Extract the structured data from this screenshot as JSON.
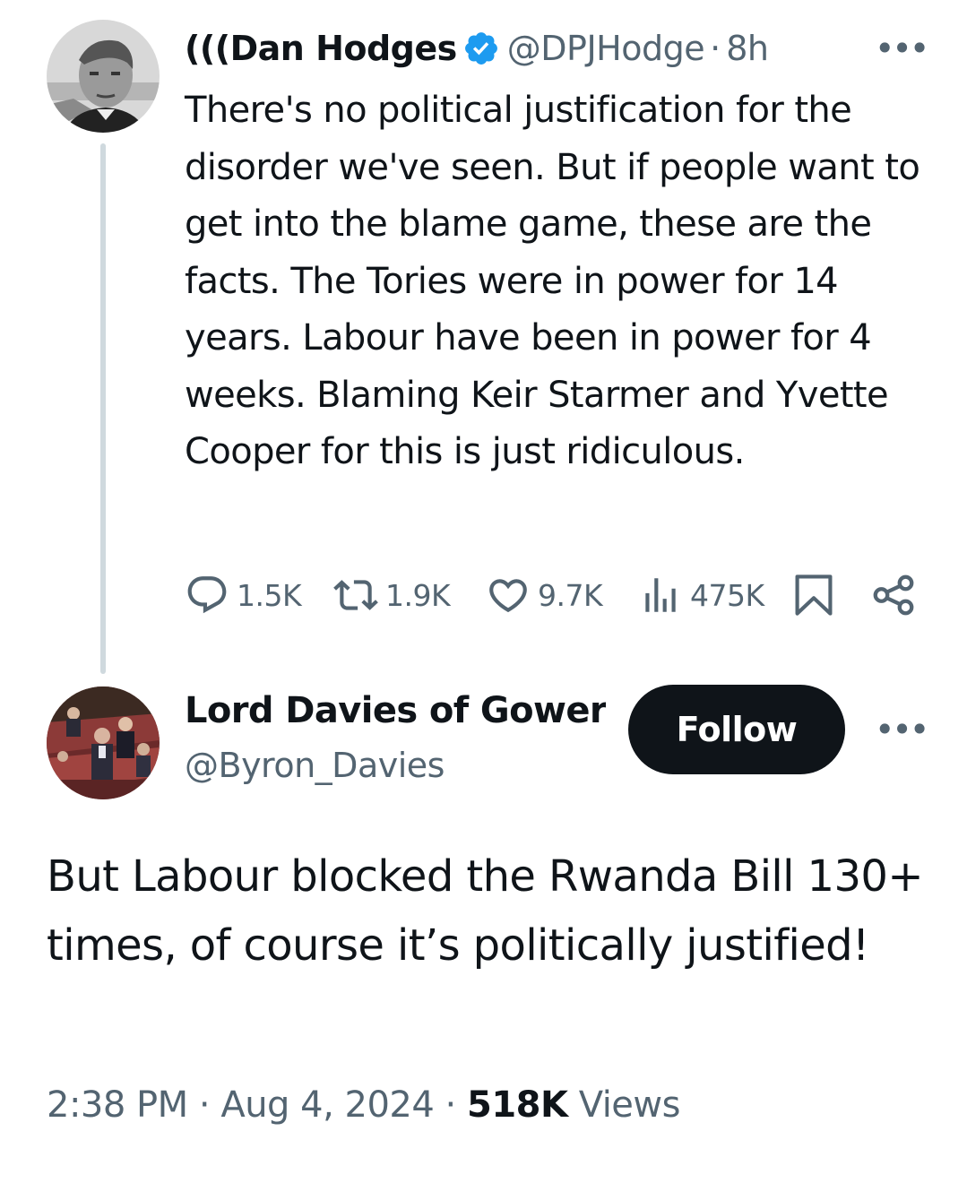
{
  "parent_tweet": {
    "display_name": "(((Dan Hodges",
    "handle": "@DPJHodge",
    "separator": "·",
    "time": "8h",
    "more_label": "•••",
    "text": "There's no political justification for the disorder we've seen. But if people want to get into the blame game, these are the facts. The Tories were in power for 14 years. Labour have been in power for 4 weeks. Blaming Keir Starmer and Yvette Cooper for this is just ridiculous.",
    "replies": "1.5K",
    "reposts": "1.9K",
    "likes": "9.7K",
    "views": "475K",
    "verified_color": "#1d9bf0",
    "icons": [
      "reply-icon",
      "repost-icon",
      "like-icon",
      "views-icon",
      "bookmark-icon",
      "share-icon"
    ]
  },
  "reply_tweet": {
    "display_name": "Lord Davies of Gower",
    "handle": "@Byron_Davies",
    "follow_label": "Follow",
    "more_label": "•••",
    "text": "But Labour blocked the Rwanda Bill 130+ times, of course it’s politically justified!",
    "time": "2:38 PM",
    "date": "Aug 4, 2024",
    "separator": "·",
    "views_count": "518K",
    "views_label": "Views"
  },
  "colors": {
    "text_primary": "#0f1419",
    "text_secondary": "#536471",
    "thread_line": "#cfd9de",
    "follow_bg": "#0f1419"
  }
}
